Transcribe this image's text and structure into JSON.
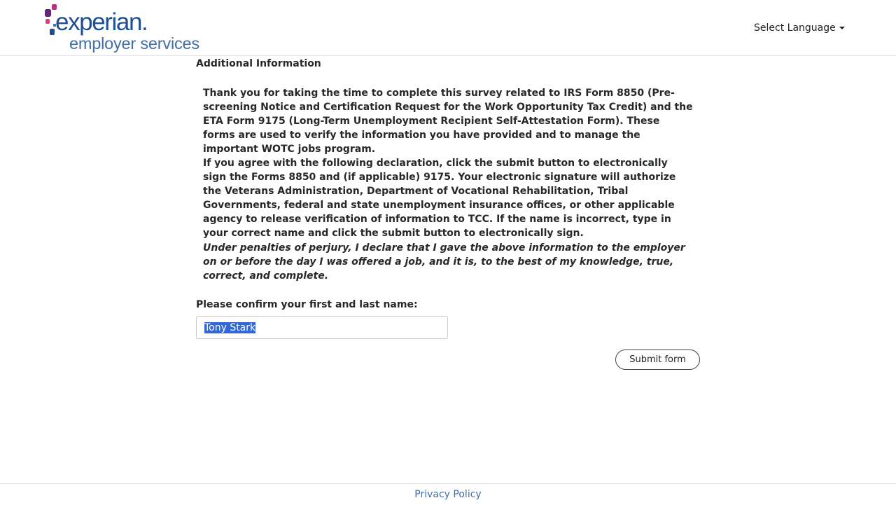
{
  "header": {
    "logo": {
      "brand": "experian.",
      "subtitle": "employer services",
      "dot_colors": [
        "#632678",
        "#ba2f7d",
        "#e63888",
        "#1d4f91",
        "#426da9"
      ]
    },
    "language_selector": {
      "label": "Select Language"
    }
  },
  "main": {
    "section_title": "Additional Information",
    "paragraphs": [
      "Thank you for taking the time to complete this survey related to IRS Form 8850 (Pre-screening Notice and Certification Request for the Work Opportunity Tax Credit) and the ETA Form 9175 (Long-Term Unemployment Recipient Self-Attestation Form). These forms are used to verify the information you have provided and to manage the important WOTC jobs program.",
      "If you agree with the following declaration, click the submit button to electronically sign the Forms 8850 and (if applicable) 9175. Your electronic signature will authorize the Veterans Administration, Department of Vocational Rehabilitation, Tribal Governments, federal and state unemployment insurance offices, or other applicable agency to release verification of information to TCC. If the name is incorrect, type in your correct name and click the submit button to electronically sign.",
      "Under penalties of perjury, I declare that I gave the above information to the employer on or before the day I was offered a job, and it is, to the best of my knowledge, true, correct, and complete."
    ],
    "confirm_label": "Please confirm your first and last name:",
    "name_field": {
      "value": "Tony Stark"
    },
    "submit_label": "Submit form"
  },
  "footer": {
    "privacy_link": "Privacy Policy"
  }
}
